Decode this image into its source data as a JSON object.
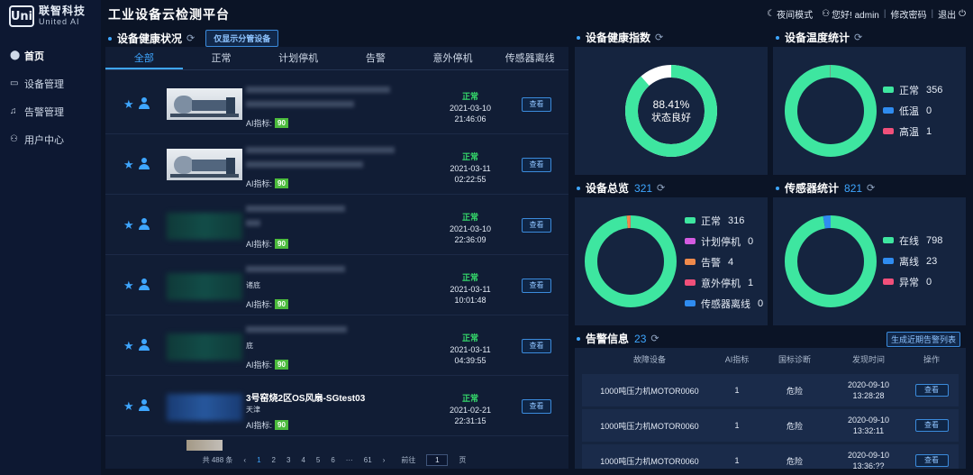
{
  "brand": {
    "mark": "Uni",
    "cn": "联智科技",
    "en": "United AI"
  },
  "sidebar": {
    "items": [
      {
        "label": "首页",
        "icon": "map-pin-icon"
      },
      {
        "label": "设备管理",
        "icon": "folder-icon"
      },
      {
        "label": "告警管理",
        "icon": "bell-icon"
      },
      {
        "label": "用户中心",
        "icon": "user-icon"
      }
    ]
  },
  "header": {
    "title": "工业设备云检测平台",
    "night_mode": "夜间模式",
    "greeting": "您好! admin",
    "change_password": "修改密码",
    "logout": "退出"
  },
  "health": {
    "title": "设备健康状况",
    "filter_button": "仅显示分管设备",
    "tabs": [
      "全部",
      "正常",
      "计划停机",
      "告警",
      "意外停机",
      "传感器离线"
    ],
    "ai_label": "AI指标:",
    "view_label": "查看",
    "rows": [
      {
        "score": "90",
        "status": "正常",
        "date": "2021-03-10",
        "time": "21:46:06",
        "name": "",
        "loc": ""
      },
      {
        "score": "90",
        "status": "正常",
        "date": "2021-03-11",
        "time": "02:22:55",
        "name": "",
        "loc": ""
      },
      {
        "score": "90",
        "status": "正常",
        "date": "2021-03-10",
        "time": "22:36:09",
        "name": "",
        "loc": ""
      },
      {
        "score": "90",
        "status": "正常",
        "date": "2021-03-11",
        "time": "10:01:48",
        "name": "",
        "loc": "诸底"
      },
      {
        "score": "90",
        "status": "正常",
        "date": "2021-03-11",
        "time": "04:39:55",
        "name": "",
        "loc": "底"
      },
      {
        "score": "90",
        "status": "正常",
        "date": "2021-02-21",
        "time": "22:31:15",
        "name": "3号窑烧2区OS风扇-SGtest03",
        "loc": "天津"
      }
    ],
    "pager": {
      "total": "共 488 条",
      "pages": [
        "1",
        "2",
        "3",
        "4",
        "5",
        "6",
        "···",
        "61"
      ],
      "prev": "‹",
      "next": "›",
      "goto_prefix": "前往",
      "goto_value": "1",
      "goto_suffix": "页"
    }
  },
  "health_index": {
    "title": "设备健康指数",
    "percent": "88.41%",
    "label": "状态良好",
    "value": 88.41,
    "colors": {
      "fill": "#3ee6a0",
      "rest": "#ffffff"
    }
  },
  "temperature": {
    "title": "设备温度统计",
    "items": [
      {
        "label": "正常",
        "value": 356,
        "color": "#3ee6a0"
      },
      {
        "label": "低温",
        "value": 0,
        "color": "#2f8cf0"
      },
      {
        "label": "高温",
        "value": 1,
        "color": "#f0507a"
      }
    ]
  },
  "overview": {
    "title": "设备总览",
    "count": "321",
    "items": [
      {
        "label": "正常",
        "value": 316,
        "color": "#3ee6a0"
      },
      {
        "label": "计划停机",
        "value": 0,
        "color": "#d45be0"
      },
      {
        "label": "告警",
        "value": 4,
        "color": "#f08a4b"
      },
      {
        "label": "意外停机",
        "value": 1,
        "color": "#f0507a"
      },
      {
        "label": "传感器离线",
        "value": 0,
        "color": "#2f8cf0"
      }
    ]
  },
  "sensors": {
    "title": "传感器统计",
    "count": "821",
    "items": [
      {
        "label": "在线",
        "value": 798,
        "color": "#3ee6a0"
      },
      {
        "label": "离线",
        "value": 23,
        "color": "#2f8cf0"
      },
      {
        "label": "异常",
        "value": 0,
        "color": "#f0507a"
      }
    ]
  },
  "alarms": {
    "title": "告警信息",
    "count": "23",
    "generate_button": "生成近期告警列表",
    "headers": [
      "故障设备",
      "AI指标",
      "国标诊断",
      "发现时间",
      "操作"
    ],
    "view_label": "查看",
    "rows": [
      {
        "device": "1000吨压力机MOTOR0060",
        "ai": "1",
        "diag": "危险",
        "date": "2020-09-10",
        "time": "13:28:28"
      },
      {
        "device": "1000吨压力机MOTOR0060",
        "ai": "1",
        "diag": "危险",
        "date": "2020-09-10",
        "time": "13:32:11"
      },
      {
        "device": "1000吨压力机MOTOR0060",
        "ai": "1",
        "diag": "危险",
        "date": "2020-09-10",
        "time": "13:36:??"
      }
    ]
  }
}
